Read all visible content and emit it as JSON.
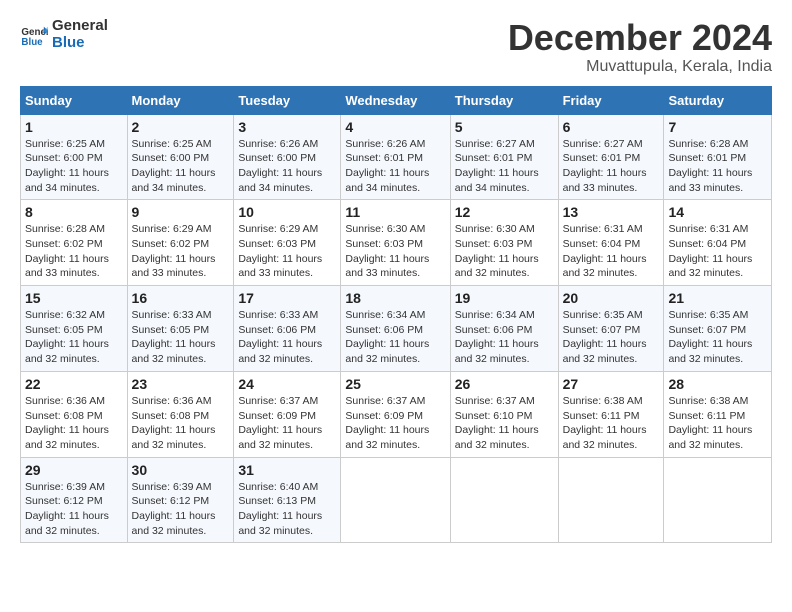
{
  "logo": {
    "text_general": "General",
    "text_blue": "Blue"
  },
  "title": "December 2024",
  "subtitle": "Muvattupula, Kerala, India",
  "columns": [
    "Sunday",
    "Monday",
    "Tuesday",
    "Wednesday",
    "Thursday",
    "Friday",
    "Saturday"
  ],
  "weeks": [
    [
      {
        "day": "1",
        "info": "Sunrise: 6:25 AM\nSunset: 6:00 PM\nDaylight: 11 hours\nand 34 minutes."
      },
      {
        "day": "2",
        "info": "Sunrise: 6:25 AM\nSunset: 6:00 PM\nDaylight: 11 hours\nand 34 minutes."
      },
      {
        "day": "3",
        "info": "Sunrise: 6:26 AM\nSunset: 6:00 PM\nDaylight: 11 hours\nand 34 minutes."
      },
      {
        "day": "4",
        "info": "Sunrise: 6:26 AM\nSunset: 6:01 PM\nDaylight: 11 hours\nand 34 minutes."
      },
      {
        "day": "5",
        "info": "Sunrise: 6:27 AM\nSunset: 6:01 PM\nDaylight: 11 hours\nand 34 minutes."
      },
      {
        "day": "6",
        "info": "Sunrise: 6:27 AM\nSunset: 6:01 PM\nDaylight: 11 hours\nand 33 minutes."
      },
      {
        "day": "7",
        "info": "Sunrise: 6:28 AM\nSunset: 6:01 PM\nDaylight: 11 hours\nand 33 minutes."
      }
    ],
    [
      {
        "day": "8",
        "info": "Sunrise: 6:28 AM\nSunset: 6:02 PM\nDaylight: 11 hours\nand 33 minutes."
      },
      {
        "day": "9",
        "info": "Sunrise: 6:29 AM\nSunset: 6:02 PM\nDaylight: 11 hours\nand 33 minutes."
      },
      {
        "day": "10",
        "info": "Sunrise: 6:29 AM\nSunset: 6:03 PM\nDaylight: 11 hours\nand 33 minutes."
      },
      {
        "day": "11",
        "info": "Sunrise: 6:30 AM\nSunset: 6:03 PM\nDaylight: 11 hours\nand 33 minutes."
      },
      {
        "day": "12",
        "info": "Sunrise: 6:30 AM\nSunset: 6:03 PM\nDaylight: 11 hours\nand 32 minutes."
      },
      {
        "day": "13",
        "info": "Sunrise: 6:31 AM\nSunset: 6:04 PM\nDaylight: 11 hours\nand 32 minutes."
      },
      {
        "day": "14",
        "info": "Sunrise: 6:31 AM\nSunset: 6:04 PM\nDaylight: 11 hours\nand 32 minutes."
      }
    ],
    [
      {
        "day": "15",
        "info": "Sunrise: 6:32 AM\nSunset: 6:05 PM\nDaylight: 11 hours\nand 32 minutes."
      },
      {
        "day": "16",
        "info": "Sunrise: 6:33 AM\nSunset: 6:05 PM\nDaylight: 11 hours\nand 32 minutes."
      },
      {
        "day": "17",
        "info": "Sunrise: 6:33 AM\nSunset: 6:06 PM\nDaylight: 11 hours\nand 32 minutes."
      },
      {
        "day": "18",
        "info": "Sunrise: 6:34 AM\nSunset: 6:06 PM\nDaylight: 11 hours\nand 32 minutes."
      },
      {
        "day": "19",
        "info": "Sunrise: 6:34 AM\nSunset: 6:06 PM\nDaylight: 11 hours\nand 32 minutes."
      },
      {
        "day": "20",
        "info": "Sunrise: 6:35 AM\nSunset: 6:07 PM\nDaylight: 11 hours\nand 32 minutes."
      },
      {
        "day": "21",
        "info": "Sunrise: 6:35 AM\nSunset: 6:07 PM\nDaylight: 11 hours\nand 32 minutes."
      }
    ],
    [
      {
        "day": "22",
        "info": "Sunrise: 6:36 AM\nSunset: 6:08 PM\nDaylight: 11 hours\nand 32 minutes."
      },
      {
        "day": "23",
        "info": "Sunrise: 6:36 AM\nSunset: 6:08 PM\nDaylight: 11 hours\nand 32 minutes."
      },
      {
        "day": "24",
        "info": "Sunrise: 6:37 AM\nSunset: 6:09 PM\nDaylight: 11 hours\nand 32 minutes."
      },
      {
        "day": "25",
        "info": "Sunrise: 6:37 AM\nSunset: 6:09 PM\nDaylight: 11 hours\nand 32 minutes."
      },
      {
        "day": "26",
        "info": "Sunrise: 6:37 AM\nSunset: 6:10 PM\nDaylight: 11 hours\nand 32 minutes."
      },
      {
        "day": "27",
        "info": "Sunrise: 6:38 AM\nSunset: 6:11 PM\nDaylight: 11 hours\nand 32 minutes."
      },
      {
        "day": "28",
        "info": "Sunrise: 6:38 AM\nSunset: 6:11 PM\nDaylight: 11 hours\nand 32 minutes."
      }
    ],
    [
      {
        "day": "29",
        "info": "Sunrise: 6:39 AM\nSunset: 6:12 PM\nDaylight: 11 hours\nand 32 minutes."
      },
      {
        "day": "30",
        "info": "Sunrise: 6:39 AM\nSunset: 6:12 PM\nDaylight: 11 hours\nand 32 minutes."
      },
      {
        "day": "31",
        "info": "Sunrise: 6:40 AM\nSunset: 6:13 PM\nDaylight: 11 hours\nand 32 minutes."
      },
      null,
      null,
      null,
      null
    ]
  ]
}
